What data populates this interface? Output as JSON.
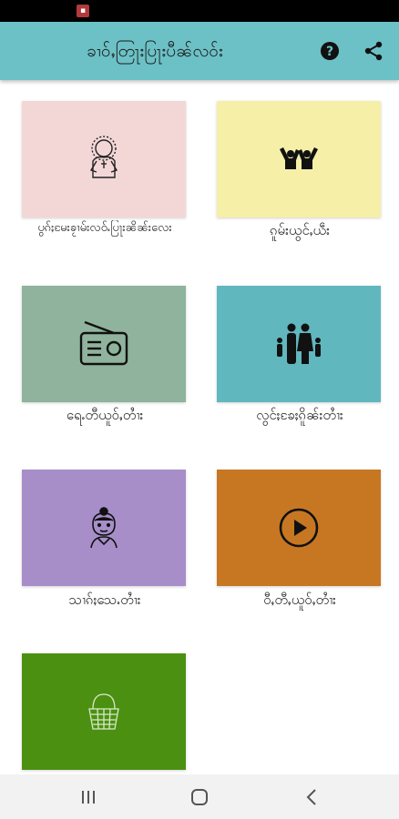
{
  "app_bar": {
    "title": "ခၢဝ်ႇတြႃးပြႃးပီၼ်လဝ်း"
  },
  "colors": {
    "app_bar": "#6cc1c6",
    "tile_prayer": "#f3d7d6",
    "tile_worship": "#f6efa8",
    "tile_radio": "#8fb39d",
    "tile_family": "#61b7be",
    "tile_women": "#a78ec9",
    "tile_video": "#c77722",
    "tile_basket": "#4c9011"
  },
  "tiles": [
    {
      "label": "ပွၵ်ႈမႄးၶႂၢမ်းလဝ်ႉပြႃးၼိၼ်းလေး",
      "icon": "prayer-icon"
    },
    {
      "label": "ၵူမ်းယွင်ႇယဵး",
      "icon": "worship-hands-icon"
    },
    {
      "label": "ရေႉတီယူဝ်ႇတၢႆး",
      "icon": "radio-icon"
    },
    {
      "label": "လွင်ႈၶႄႈၵိူၼ်းတၢႆး",
      "icon": "family-icon"
    },
    {
      "label": "သၢၵ်ႈသေႉတၢႆး",
      "icon": "woman-icon"
    },
    {
      "label": "ဝီႇတီႇယူဝ်ႇတၢႆး",
      "icon": "play-icon"
    },
    {
      "label": "",
      "icon": "basket-icon"
    }
  ]
}
